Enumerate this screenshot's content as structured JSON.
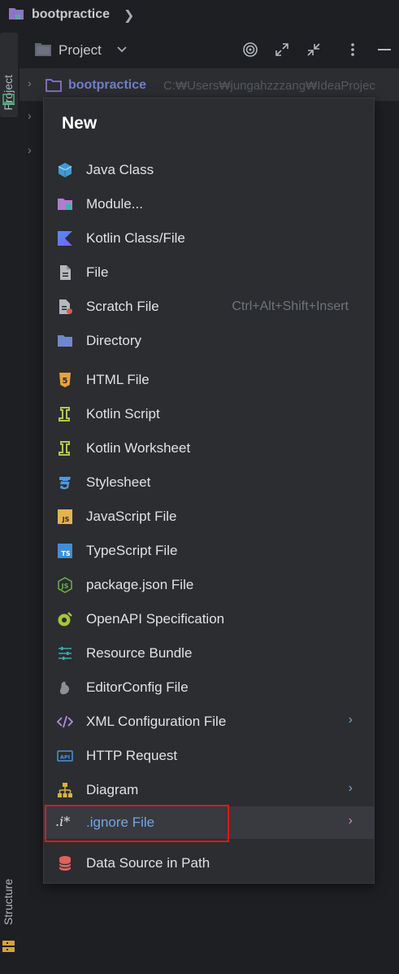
{
  "breadcrumb": {
    "project_name": "bootpractice",
    "chevron": "❯"
  },
  "stripe": {
    "project_label": "Project",
    "structure_label": "Structure"
  },
  "pane": {
    "title": "Project",
    "dropdown_glyph": "⌄",
    "buttons": {
      "locate": "locate-icon",
      "expand": "expand-icon",
      "collapse": "collapse-icon",
      "more": "⋮",
      "minimize": "—"
    }
  },
  "tree": {
    "root_name": "bootpractice",
    "root_path": "C:₩Users₩jungahzzzang₩IdeaProjec",
    "arrow": "›"
  },
  "menu": {
    "title": "New",
    "items": [
      {
        "label": "Java Class",
        "icon": "java-class-icon"
      },
      {
        "label": "Module...",
        "icon": "module-icon"
      },
      {
        "label": "Kotlin Class/File",
        "icon": "kotlin-icon"
      },
      {
        "label": "File",
        "icon": "file-icon"
      },
      {
        "label": "Scratch File",
        "icon": "scratch-file-icon",
        "shortcut": "Ctrl+Alt+Shift+Insert"
      },
      {
        "label": "Directory",
        "icon": "directory-icon"
      },
      {
        "label": "HTML File",
        "icon": "html5-icon"
      },
      {
        "label": "Kotlin Script",
        "icon": "kotlin-script-icon"
      },
      {
        "label": "Kotlin Worksheet",
        "icon": "kotlin-worksheet-icon"
      },
      {
        "label": "Stylesheet",
        "icon": "css3-icon"
      },
      {
        "label": "JavaScript File",
        "icon": "javascript-icon"
      },
      {
        "label": "TypeScript File",
        "icon": "typescript-icon"
      },
      {
        "label": "package.json File",
        "icon": "nodejs-icon"
      },
      {
        "label": "OpenAPI Specification",
        "icon": "openapi-icon"
      },
      {
        "label": "Resource Bundle",
        "icon": "resource-bundle-icon"
      },
      {
        "label": "EditorConfig File",
        "icon": "editorconfig-icon"
      },
      {
        "label": "XML Configuration File",
        "icon": "xml-icon",
        "submenu": "›"
      },
      {
        "label": "HTTP Request",
        "icon": "api-icon"
      },
      {
        "label": "Diagram",
        "icon": "diagram-icon",
        "submenu": "›"
      },
      {
        "label": ".ignore File",
        "icon": "ignore-file-icon",
        "icon_text": ".i*",
        "submenu": "›",
        "highlighted": true
      },
      {
        "label": "Data Source in Path",
        "icon": "database-icon"
      }
    ]
  },
  "colors": {
    "background": "#1e1f22",
    "menu_bg": "#2b2d30",
    "highlight_bg": "#383a3f",
    "highlight_text": "#72a6e4",
    "annotation_red": "#e0161d"
  }
}
